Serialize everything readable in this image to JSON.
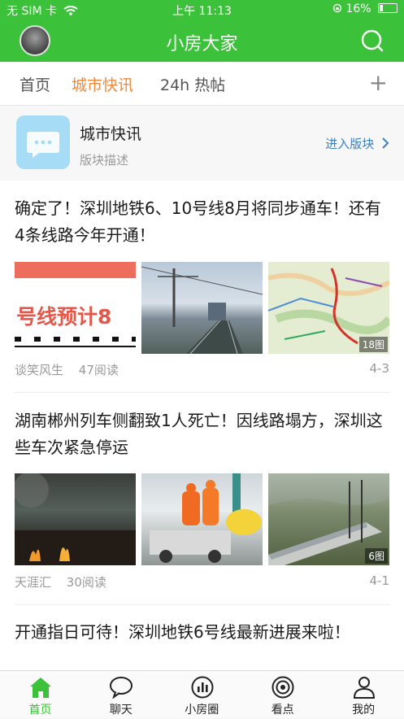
{
  "status_bar": {
    "carrier": "无 SIM 卡",
    "time": "上午 11:13",
    "battery": "16%"
  },
  "nav": {
    "title": "小房大家"
  },
  "tabs": [
    {
      "label": "首页"
    },
    {
      "label": "城市快讯"
    },
    {
      "label": "24h 热帖"
    }
  ],
  "section": {
    "title": "城市快讯",
    "description": "版块描述",
    "enter_label": "进入版块"
  },
  "articles": [
    {
      "title": "确定了！深圳地铁6、10号线8月将同步通车！还有4条线路今年开通！",
      "image_caption": "号线预计8",
      "image_count": "18图",
      "author": "谈笑风生",
      "reads": "47阅读",
      "date": "4-3"
    },
    {
      "title": "湖南郴州列车侧翻致1人死亡！因线路塌方，深圳这些车次紧急停运",
      "image_count": "6图",
      "author": "天涯汇",
      "reads": "30阅读",
      "date": "4-1"
    },
    {
      "title": "开通指日可待！深圳地铁6号线最新进展来啦！"
    }
  ],
  "tabbar": [
    {
      "label": "首页",
      "icon": "home-icon"
    },
    {
      "label": "聊天",
      "icon": "chat-icon"
    },
    {
      "label": "小房圈",
      "icon": "stats-icon"
    },
    {
      "label": "看点",
      "icon": "target-icon"
    },
    {
      "label": "我的",
      "icon": "person-icon"
    }
  ],
  "colors": {
    "brand": "#3cc13a",
    "accent": "#f08a3a",
    "link": "#3a7fc1"
  }
}
